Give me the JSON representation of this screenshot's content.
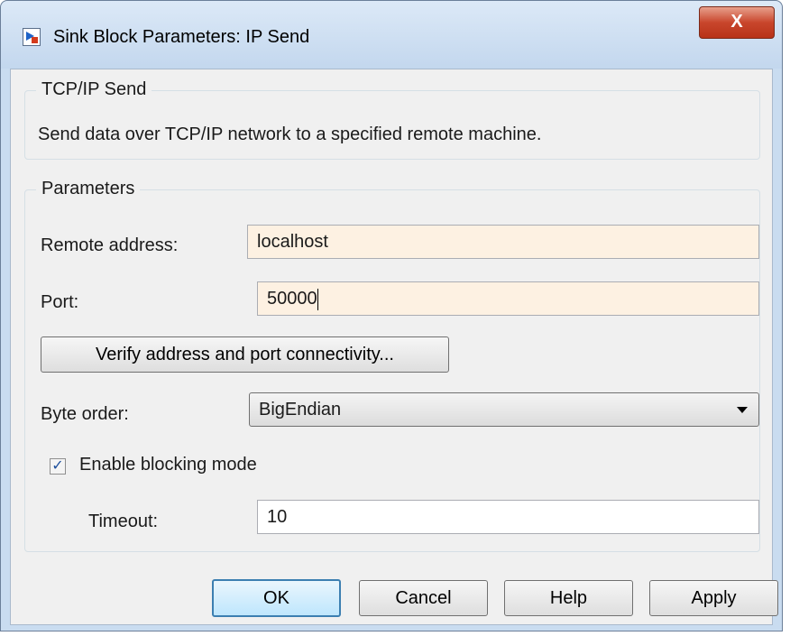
{
  "window": {
    "title": "Sink Block Parameters: IP Send",
    "close_glyph": "X"
  },
  "description_group": {
    "title": "TCP/IP Send",
    "text": "Send data over TCP/IP network to a specified remote machine."
  },
  "parameters_group": {
    "title": "Parameters",
    "remote_address": {
      "label": "Remote address:",
      "value": "localhost"
    },
    "port": {
      "label": "Port:",
      "value": "50000"
    },
    "verify_button": "Verify address and port connectivity...",
    "byte_order": {
      "label": "Byte order:",
      "value": "BigEndian"
    },
    "blocking_mode": {
      "label": "Enable blocking mode",
      "checked": true,
      "check_glyph": "✓"
    },
    "timeout": {
      "label": "Timeout:",
      "value": "10"
    }
  },
  "buttons": {
    "ok": "OK",
    "cancel": "Cancel",
    "help": "Help",
    "apply": "Apply"
  },
  "colors": {
    "edited_field_bg": "#fdf1e2",
    "default_button_border": "#3c7fb1",
    "close_button": "#c9462c"
  }
}
